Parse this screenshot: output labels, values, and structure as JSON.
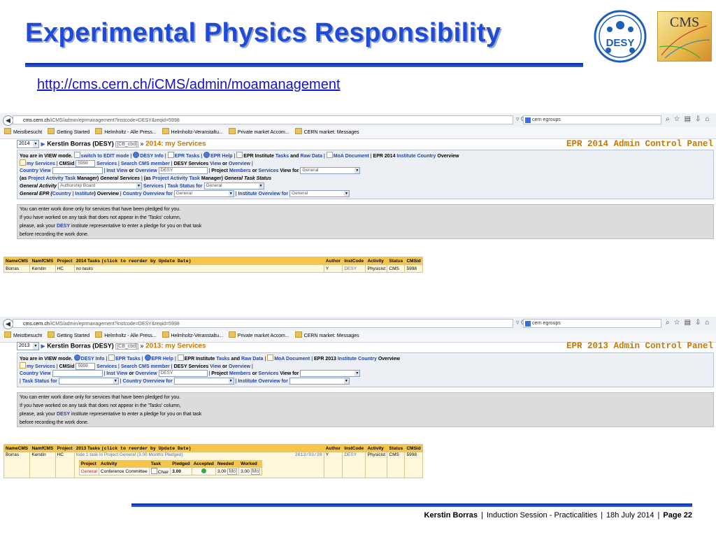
{
  "slide": {
    "title": "Experimental Physics Responsibility",
    "url": "http://cms.cern.ch/iCMS/admin/moamanagement",
    "desy_logo_text": "DESY",
    "cms_logo_text": "CMS",
    "footer": {
      "author": "Kerstin Borras",
      "session": "Induction Session - Practicalities",
      "date": "18h  July 2014",
      "page": "Page 22"
    }
  },
  "browser": {
    "url_1_host": "cms.cern.ch",
    "url_1_path": "/iCMS/admin/eprmanagement?instcode=DESY&reqid=5998",
    "url_2_host": "cms.cern.ch",
    "url_2_path": "/iCMS/admin/eprmanagement?instcode=DESY&reqid=5998",
    "reload": "▿ C",
    "search_value": "cern egroups",
    "bookmarks": [
      "Meistbesucht",
      "Getting Started",
      "Helmholtz - Alle Press...",
      "Helmholtz-Veranstaltu...",
      "Private market Accom...",
      "CERN market: Messages"
    ]
  },
  "shared": {
    "user": "Kerstin Borras (DESY)",
    "cb_tag": "[CB_cbd]",
    "raquo": "»",
    "my_services": "my Services",
    "view_mode": "You are in VIEW mode.",
    "switch_edit": "switch to EDIT mode",
    "desy_info": "DESY Info",
    "epr_tasks": "EPR Tasks",
    "epr_help": "EPR Help",
    "epr_institute": "EPR Institute",
    "tasks": "Tasks",
    "and": "and",
    "raw_data": "Raw Data",
    "moa_doc": "MoA Document",
    "institute_country": "Institute Country",
    "overview": "Overview",
    "my_services_link": "my Services",
    "cmsid_label": "CMSid",
    "cmsid_value": "5998",
    "services": "Services",
    "search_member": "Search CMS member",
    "desy_services": "DESY Services",
    "view": "View",
    "or": "or",
    "country_view": "Country View",
    "inst_view": "Inst View",
    "overview_label": "Overview",
    "desy_input": "DESY",
    "project": "Project",
    "members": "Members",
    "view_for": "View for",
    "general": "General",
    "note_lines": [
      "You can enter work done only for services that have been pledged for you.",
      "If you have worked on any task that does not appear in the 'Tasks' column,",
      "please, ask your",
      "DESY",
      "institute representative to enter a pledge for you on that task",
      "before recording the work done."
    ],
    "tbl_headers": [
      "NameCMS",
      "NamfCMS",
      "Project",
      "Author",
      "InstCode",
      "Activity",
      "Status",
      "CMSid"
    ],
    "tasks_hint": "(click to reorder by Update Date)"
  },
  "panel2014": {
    "year": "2014",
    "heading_year": "2014:",
    "panel_title": "EPR 2014 Admin Control Panel",
    "epr_year_label": "EPR 2014",
    "row3_prefix": "(as",
    "project_activity_task": "Project Activity Task",
    "manager": "Manager)",
    "general_services": "General Services",
    "as2": "(as",
    "manager2": "Manager)",
    "general_task_status": "General Task Status",
    "general_activity": "General Activity",
    "activity_value": "Authorship Board",
    "services_link": "Services",
    "task_status_for": "Task Status for",
    "general_epr": "General EPR (",
    "country": "Country",
    "institute": "Institute",
    "overview_close": ") Overview",
    "country_overview_for": "Country Overview for",
    "institute_overview_for": "Institute Overview for",
    "tasks_col": "2014 Tasks",
    "row": {
      "namecms": "Borras",
      "namfcms": "Kerstin",
      "project": "HC",
      "tasks": "no tasks",
      "author": "Y",
      "instcode": "DESY",
      "activity": "Physicist",
      "status": "CMS",
      "cmsid": "5998"
    }
  },
  "panel2013": {
    "year": "2013",
    "heading_year": "2013:",
    "panel_title": "EPR 2013 Admin Control Panel",
    "epr_year_label": "EPR 2013",
    "task_status_for": "Task Status for",
    "country_overview_for": "Country Overview for",
    "institute_overview_for": "Institute Overview for",
    "tasks_col": "2013 Tasks",
    "row": {
      "namecms": "Borras",
      "namfcms": "Kerstin",
      "project": "HC",
      "hide": "hide 1 task in Project General (3.00 Months Pledged)",
      "date": "2013/03/28",
      "author": "Y",
      "instcode": "DESY",
      "activity": "Physicist",
      "status": "CMS",
      "cmsid": "5998"
    },
    "sub_headers": [
      "Project",
      "Activity",
      "Task",
      "Pledged",
      "Accepted",
      "Needed",
      "Worked"
    ],
    "sub_row": {
      "project": "General",
      "activity": "Conference Committee",
      "task": "Chair",
      "pledged": "3.00",
      "needed": "3.00",
      "needed_unit": "Mo",
      "worked": "3.00",
      "worked_unit": "Mo"
    }
  }
}
